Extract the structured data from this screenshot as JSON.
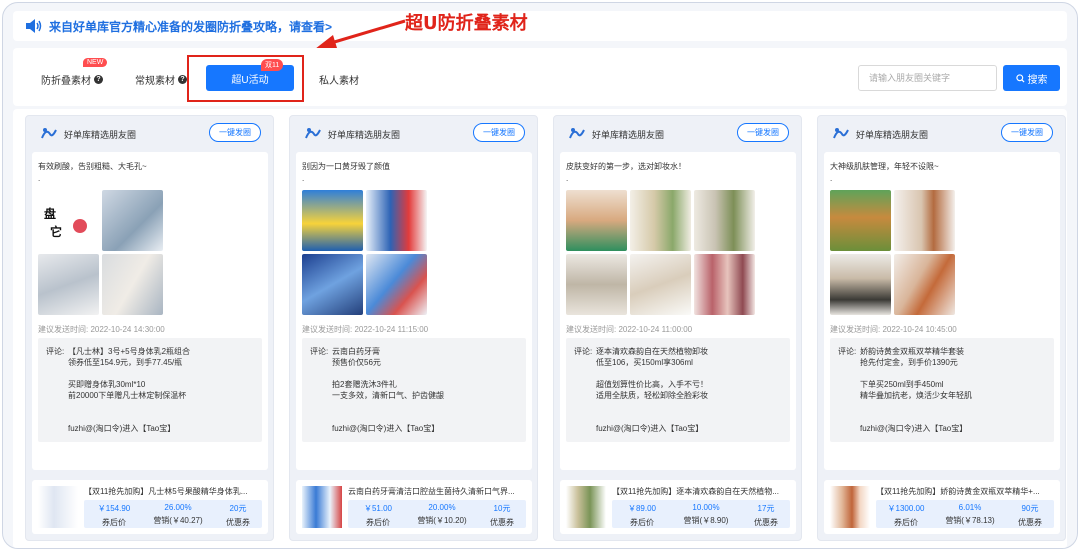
{
  "notice": {
    "text": "来自好单库官方精心准备的发圈防折叠攻略，请查看>"
  },
  "callout": {
    "text": "超U防折叠素材"
  },
  "tabs": [
    {
      "label": "防折叠素材",
      "badge": "NEW"
    },
    {
      "label": "常规素材"
    },
    {
      "label": "超U活动",
      "badge": "双11",
      "active": true
    },
    {
      "label": "私人素材"
    }
  ],
  "search": {
    "placeholder": "请输入朋友圈关键字",
    "button": "搜索"
  },
  "cards": [
    {
      "title": "好单库精选朋友圈",
      "share": "一键发圈",
      "text": "有效刷酸，告别粗糙、大毛孔~",
      "dot": ".",
      "time": "建议发送时间: 2022-10-24 14:30:00",
      "comment_label": "评论:",
      "comment": [
        "【凡士林】3号+5号身体乳2瓶组合",
        "领券低至154.9元，到手77.45/瓶",
        "",
        "买即赠身体乳30ml*10",
        "前20000下单赠凡士林定制保温杯",
        "",
        "",
        "fuzhi@(淘口令)进入【Tao宝】"
      ],
      "product": {
        "title": "【双11抢先加购】凡士林5号果酸精华身体乳...",
        "v1": "￥154.90",
        "k1": "券后价",
        "v2": "26.00%",
        "k2": "营销(￥40.27)",
        "v3": "20元",
        "k3": "优惠券"
      }
    },
    {
      "title": "好单库精选朋友圈",
      "share": "一键发圈",
      "text": "别因为一口黄牙毁了颜值",
      "dot": ".",
      "time": "建议发送时间: 2022-10-24 11:15:00",
      "comment_label": "评论:",
      "comment": [
        "云南白药牙膏",
        "预售价仅56元",
        "",
        "拍2套赠洗沐3件礼",
        "一支多效，清新口气、护齿健龈",
        "",
        "",
        "fuzhi@(淘口令)进入【Tao宝】"
      ],
      "product": {
        "title": "云南白药牙膏清洁口腔益生菌持久清新口气界...",
        "v1": "￥51.00",
        "k1": "券后价",
        "v2": "20.00%",
        "k2": "营销(￥10.20)",
        "v3": "10元",
        "k3": "优惠券"
      }
    },
    {
      "title": "好单库精选朋友圈",
      "share": "一键发圈",
      "text": "皮肤变好的第一步，选对卸妆水！",
      "dot": ".",
      "time": "建议发送时间: 2022-10-24 11:00:00",
      "comment_label": "评论:",
      "comment": [
        "逐本清欢森韵自在天然植物卸妆",
        "低至106，买150ml享306ml",
        "",
        "超值划算性价比高，入手不亏！",
        "适用全肤质，轻松卸除全脸彩妆",
        "",
        "",
        "fuzhi@(淘口令)进入【Tao宝】"
      ],
      "product": {
        "title": "【双11抢先加购】逐本清欢森韵自在天然植物...",
        "v1": "￥89.00",
        "k1": "券后价",
        "v2": "10.00%",
        "k2": "营销(￥8.90)",
        "v3": "17元",
        "k3": "优惠券"
      }
    },
    {
      "title": "好单库精选朋友圈",
      "share": "一键发圈",
      "text": "大神级肌肤管理，年轻不设限~",
      "dot": ".",
      "time": "建议发送时间: 2022-10-24 10:45:00",
      "comment_label": "评论:",
      "comment": [
        "娇韵诗黄金双瓶双萃精华套装",
        "抢先付定金，到手价1390元",
        "",
        "下单买250ml到手450ml",
        "精华叠加抗老，焕活少女年轻肌",
        "",
        "",
        "fuzhi@(淘口令)进入【Tao宝】"
      ],
      "product": {
        "title": "【双11抢先加购】娇韵诗黄金双瓶双萃精华+...",
        "v1": "￥1300.00",
        "k1": "券后价",
        "v2": "6.01%",
        "k2": "营销(￥78.13)",
        "v3": "90元",
        "k3": "优惠券"
      }
    }
  ],
  "colors": {
    "accent": "#1677ff",
    "callout": "#e0241a",
    "badge": "#ff4d4f"
  }
}
